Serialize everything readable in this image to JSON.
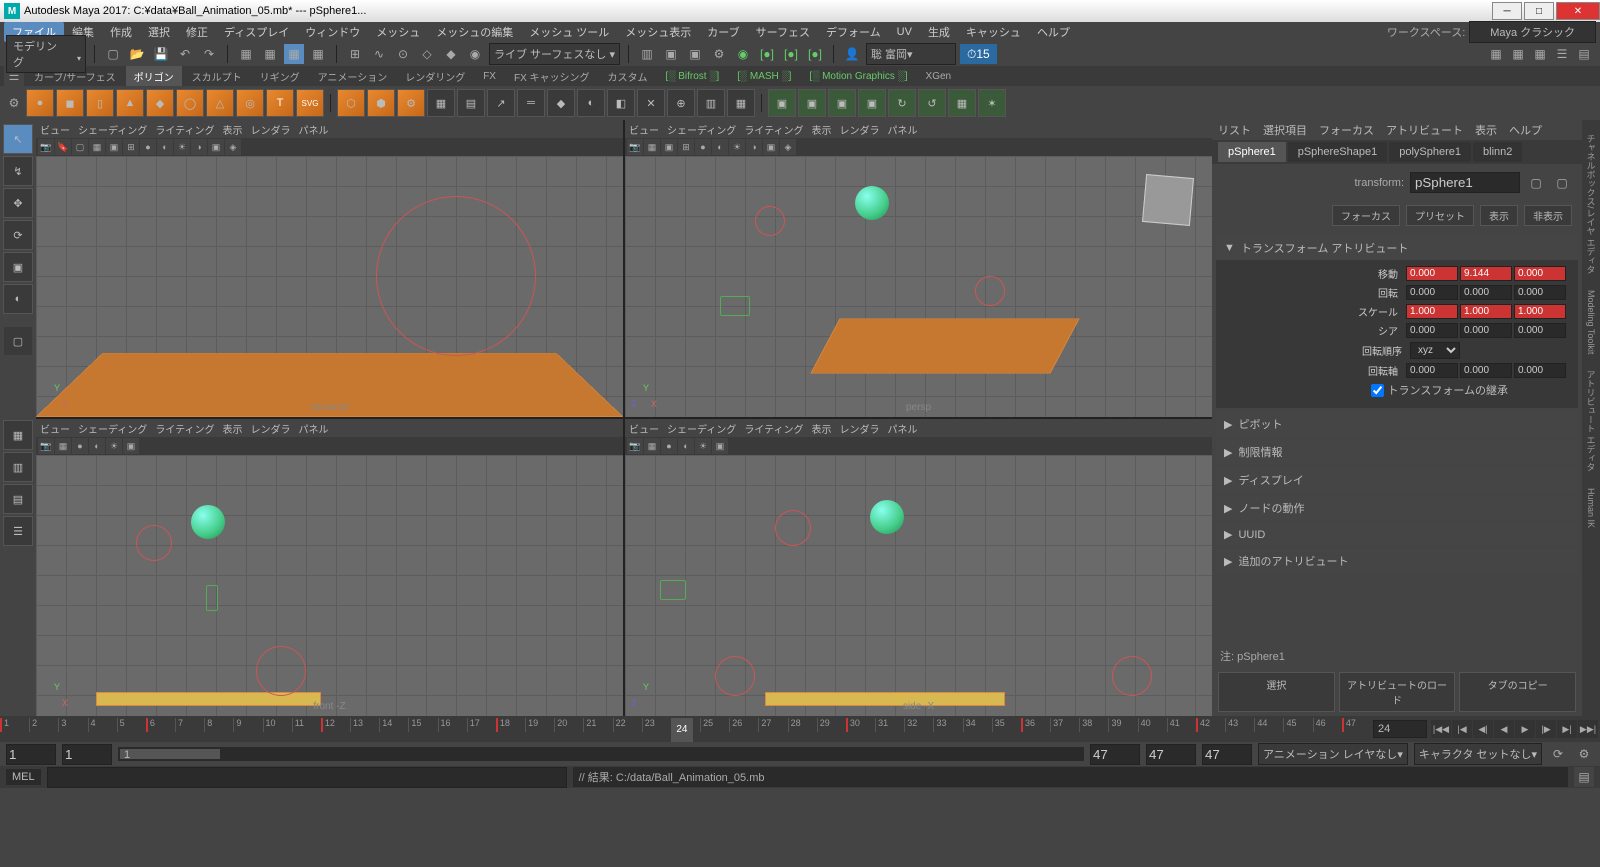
{
  "title": "Autodesk Maya 2017: C:¥data¥Ball_Animation_05.mb*  ---  pSphere1...",
  "menubar": {
    "items": [
      "ファイル",
      "編集",
      "作成",
      "選択",
      "修正",
      "ディスプレイ",
      "ウィンドウ",
      "メッシュ",
      "メッシュの編集",
      "メッシュ ツール",
      "メッシュ表示",
      "カーブ",
      "サーフェス",
      "デフォーム",
      "UV",
      "生成",
      "キャッシュ",
      "ヘルプ"
    ],
    "workspace_label": "ワークスペース:",
    "workspace_value": "Maya クラシック"
  },
  "statusline": {
    "mode": "モデリング",
    "user": "聡 富岡",
    "fps": "15"
  },
  "shelfTabs": [
    "カーブ/サーフェス",
    "ポリゴン",
    "スカルプト",
    "リギング",
    "アニメーション",
    "レンダリング",
    "FX",
    "FX キャッシング",
    "カスタム",
    "Bifrost",
    "MASH",
    "Motion Graphics",
    "XGen"
  ],
  "activeShelfTab": 1,
  "vpMenu": [
    "ビュー",
    "シェーディング",
    "ライティング",
    "表示",
    "レンダラ",
    "パネル"
  ],
  "vpLabels": {
    "tl": "camera1",
    "tr": "persp",
    "bl": "front -Z",
    "br": "side -X"
  },
  "attr": {
    "menu": [
      "リスト",
      "選択項目",
      "フォーカス",
      "アトリビュート",
      "表示",
      "ヘルプ"
    ],
    "tabs": [
      "pSphere1",
      "pSphereShape1",
      "polySphere1",
      "blinn2"
    ],
    "transform_label": "transform:",
    "transform_value": "pSphere1",
    "btn_focus": "フォーカス",
    "btn_preset": "プリセット",
    "btn_show": "表示",
    "btn_hide": "非表示",
    "sec_transform": "トランスフォーム アトリビュート",
    "r_translate": "移動",
    "r_rotate": "回転",
    "r_scale": "スケール",
    "r_shear": "シア",
    "r_order": "回転順序",
    "r_axis": "回転軸",
    "translate": [
      "0.000",
      "9.144",
      "0.000"
    ],
    "rotate": [
      "0.000",
      "0.000",
      "0.000"
    ],
    "scale": [
      "1.000",
      "1.000",
      "1.000"
    ],
    "shear": [
      "0.000",
      "0.000",
      "0.000"
    ],
    "order": "xyz",
    "axis": [
      "0.000",
      "0.000",
      "0.000"
    ],
    "inherit": "トランスフォームの継承",
    "sections": [
      "ピボット",
      "制限情報",
      "ディスプレイ",
      "ノードの動作",
      "UUID",
      "追加のアトリビュート"
    ],
    "note_label": "注:",
    "note_value": "pSphere1",
    "foot": [
      "選択",
      "アトリビュートのロード",
      "タブのコピー"
    ]
  },
  "rtabs": [
    "チャネルボックス/レイヤ エディタ",
    "Modeling Toolkit",
    "アトリビュート エディタ",
    "Human IK"
  ],
  "timeline": {
    "ticks": [
      1,
      2,
      3,
      4,
      5,
      6,
      7,
      8,
      9,
      10,
      11,
      12,
      13,
      14,
      15,
      16,
      17,
      18,
      19,
      20,
      21,
      22,
      23,
      24,
      25,
      26,
      27,
      28,
      29,
      30,
      31,
      32,
      33,
      34,
      35,
      36,
      37,
      38,
      39,
      40,
      41,
      42,
      43,
      44,
      45,
      46,
      47
    ],
    "current": 24,
    "end": "24",
    "keys": [
      1,
      6,
      12,
      18,
      24,
      30,
      36,
      42,
      47
    ]
  },
  "range": {
    "start": "1",
    "innerStart": "1",
    "rangeDisp": "1",
    "end": "47",
    "outerEnd": "47",
    "outerEnd2": "47",
    "animlayer": "アニメーション レイヤなし",
    "charset": "キャラクタ セットなし"
  },
  "cmd": {
    "lang": "MEL",
    "result": "// 結果: C:/data/Ball_Animation_05.mb"
  }
}
